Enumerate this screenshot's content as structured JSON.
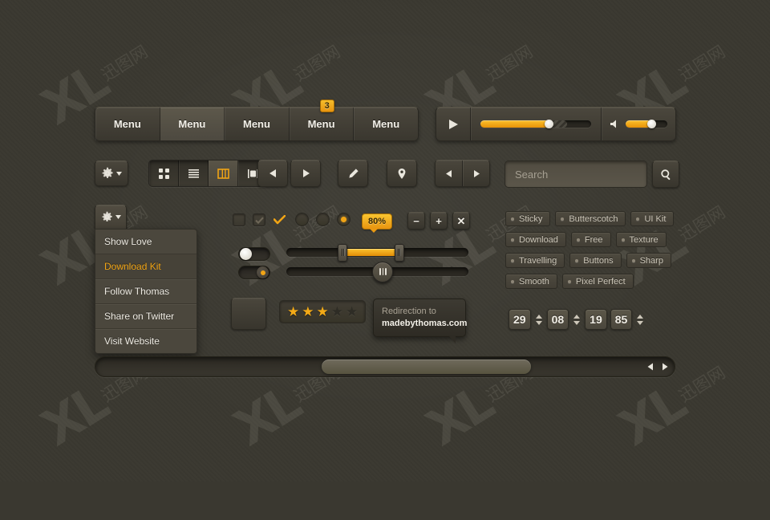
{
  "theme": {
    "background": "#3a3830",
    "accent": "#f0a415",
    "panel": "#4a463c",
    "text": "#efece4",
    "muted": "#a59f91"
  },
  "watermark": {
    "text": "XL",
    "sub": "迅图网",
    "repeat": 12
  },
  "menubar": {
    "tabs": [
      {
        "label": "Menu",
        "active": false,
        "badge": null
      },
      {
        "label": "Menu",
        "active": true,
        "badge": null
      },
      {
        "label": "Menu",
        "active": false,
        "badge": null
      },
      {
        "label": "Menu",
        "active": false,
        "badge": "3"
      },
      {
        "label": "Menu",
        "active": false,
        "badge": null
      }
    ]
  },
  "player": {
    "play_icon": "play-icon",
    "volume_icon": "speaker-icon",
    "seek_percent": 62,
    "buffer_percent": 78,
    "volume_percent": 62
  },
  "toolbar": {
    "gear_label": "gear-icon",
    "view_modes": [
      {
        "icon": "grid-view-icon",
        "active": false
      },
      {
        "icon": "list-view-icon",
        "active": false
      },
      {
        "icon": "column-view-icon",
        "active": true
      },
      {
        "icon": "split-view-icon",
        "active": false
      }
    ],
    "buttons": [
      {
        "icon": "arrow-left-icon"
      },
      {
        "icon": "arrow-right-icon"
      },
      {
        "icon": "pencil-icon"
      },
      {
        "icon": "map-pin-icon"
      }
    ],
    "pager": [
      {
        "icon": "arrow-left-icon"
      },
      {
        "icon": "arrow-right-icon"
      }
    ]
  },
  "search": {
    "placeholder": "Search",
    "value": "",
    "button_icon": "search-icon"
  },
  "dropdown": {
    "toggle_icon": "gear-icon",
    "items": [
      {
        "label": "Show Love",
        "highlight": false
      },
      {
        "label": "Download Kit",
        "highlight": true
      },
      {
        "label": "Follow Thomas",
        "highlight": false
      },
      {
        "label": "Share on Twitter",
        "highlight": false
      },
      {
        "label": "Visit Website",
        "highlight": false
      }
    ]
  },
  "controls": {
    "checkboxes": [
      {
        "state": "unchecked"
      },
      {
        "state": "checked-dark"
      },
      {
        "state": "checked-accent"
      }
    ],
    "radios": [
      {
        "state": "off"
      },
      {
        "state": "off"
      },
      {
        "state": "on"
      }
    ],
    "percent_badge": "80%",
    "mini_buttons": [
      {
        "label": "−",
        "name": "minus-button"
      },
      {
        "label": "+",
        "name": "plus-button"
      },
      {
        "label": "✕",
        "name": "close-button"
      }
    ]
  },
  "toggles": [
    {
      "state": "off",
      "knob": "white"
    },
    {
      "state": "on",
      "knob": "amber"
    }
  ],
  "sliders": {
    "range": {
      "start_percent": 31,
      "end_percent": 62
    },
    "single": {
      "value_percent": 53
    }
  },
  "tags": [
    "Sticky",
    "Butterscotch",
    "UI Kit",
    "Download",
    "Free",
    "Texture",
    "Travelling",
    "Buttons",
    "Sharp",
    "Smooth",
    "Pixel Perfect"
  ],
  "rating": {
    "value": 3,
    "max": 5
  },
  "tooltip": {
    "line1": "Redirection to",
    "line2": "madebythomas.com"
  },
  "date_stepper": {
    "fields": [
      {
        "value": "29",
        "name": "day-field"
      },
      {
        "value": "08",
        "name": "month-field"
      },
      {
        "value": "19",
        "name": "year-century-field"
      },
      {
        "value": "85",
        "name": "year-field"
      }
    ]
  },
  "scrollbar": {
    "thumb_position_percent": 39,
    "thumb_size_percent": 36
  }
}
